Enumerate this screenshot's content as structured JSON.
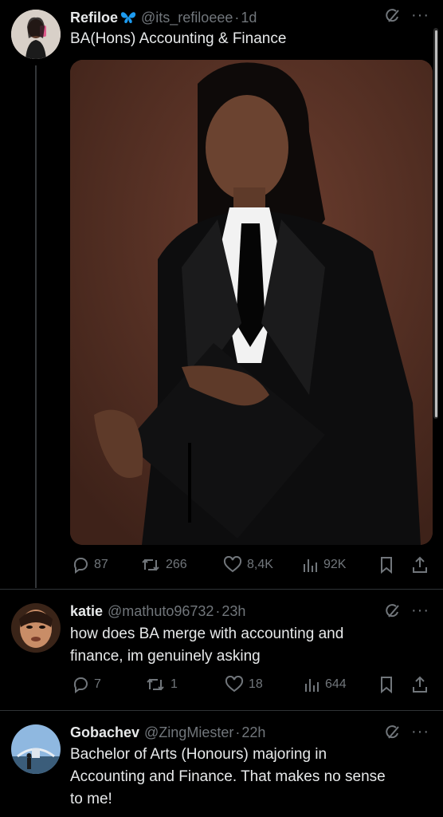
{
  "tweet": {
    "author": {
      "name": "Refiloe",
      "verified_badge": "butterfly",
      "handle": "@its_refiloeee",
      "time": "1d"
    },
    "text": "BA(Hons) Accounting & Finance",
    "actions": {
      "replies": "87",
      "reposts": "266",
      "likes": "8,4K",
      "views": "92K"
    }
  },
  "replies": [
    {
      "name": "katie",
      "handle": "@mathuto96732",
      "time": "23h",
      "lines": [
        "how does BA merge with accounting and",
        "finance, im  genuinely asking"
      ],
      "actions": {
        "replies": "7",
        "reposts": "1",
        "likes": "18",
        "views": "644"
      }
    },
    {
      "name": "Gobachev",
      "handle": "@ZingMiester",
      "time": "22h",
      "lines": [
        "Bachelor of Arts (Honours) majoring in",
        "Accounting and Finance. That makes no sense",
        "to me!"
      ]
    }
  ],
  "icons": [
    "grok-icon",
    "more-icon",
    "reply-icon",
    "repost-icon",
    "like-icon",
    "views-icon",
    "bookmark-icon",
    "share-icon",
    "butterfly-icon"
  ],
  "colors": {
    "background": "#000000",
    "text": "#e7e9ea",
    "muted": "#71767b",
    "badge": "#1d9bf0",
    "photo_bg": "#4a2a20"
  }
}
